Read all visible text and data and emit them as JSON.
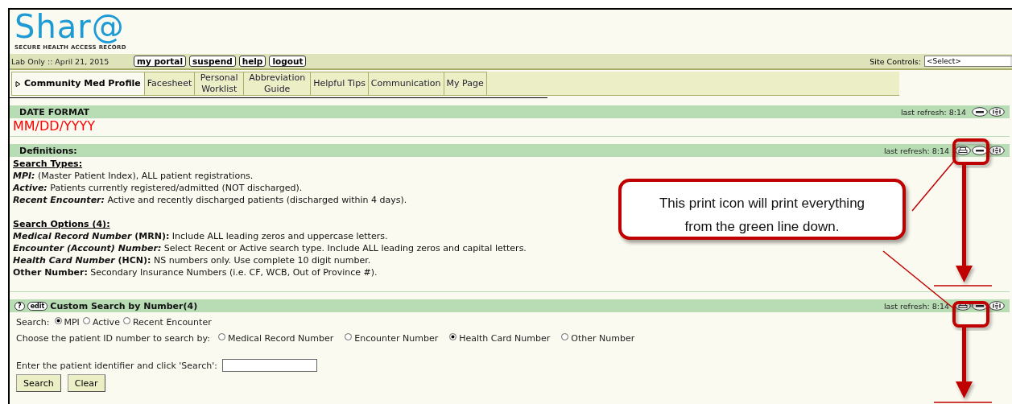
{
  "logo": {
    "name": "Shar@",
    "tagline": "SECURE HEALTH ACCESS RECORD"
  },
  "toolbar": {
    "context": "Lab Only :: April 21, 2015",
    "buttons": [
      "my portal",
      "suspend",
      "help",
      "logout"
    ],
    "site_controls_label": "Site Controls:",
    "site_controls_value": "<Select>"
  },
  "tabs": [
    {
      "label": "Community Med Profile",
      "selected": true
    },
    {
      "label": "Facesheet",
      "selected": false
    },
    {
      "label": "Personal Worklist",
      "selected": false
    },
    {
      "label": "Abbreviation Guide",
      "selected": false
    },
    {
      "label": "Helpful Tips",
      "selected": false
    },
    {
      "label": "Communication",
      "selected": false
    },
    {
      "label": "My Page",
      "selected": false
    }
  ],
  "panels": [
    {
      "title": "DATE FORMAT",
      "refresh": "last refresh: 8:14",
      "printable": false,
      "kind": "date",
      "value": "MM/DD/YYYY"
    },
    {
      "title": "Definitions:",
      "refresh": "last refresh: 8:14",
      "printable": true,
      "kind": "definitions",
      "sections": [
        {
          "heading": "Search Types:",
          "lines": [
            {
              "term": "MPI:",
              "text": " (Master Patient Index), ALL patient registrations."
            },
            {
              "term": "Active:",
              "text": " Patients currently registered/admitted (NOT discharged)."
            },
            {
              "term": "Recent Encounter:",
              "text": " Active and recently discharged patients (discharged within 4 days)."
            }
          ]
        },
        {
          "heading": "Search Options (4):",
          "lines": [
            {
              "term": "Medical Record Number",
              "label": " (MRN):",
              "text": " Include ALL leading zeros and uppercase letters."
            },
            {
              "term": "Encounter (Account) Number:",
              "text": " Select Recent or Active search type. Include ALL leading zeros and capital letters."
            },
            {
              "term": "Health Card Number",
              "label": " (HCN):",
              "text": " NS numbers only. Use complete 10 digit number."
            },
            {
              "label": "Other Number:",
              "text": " Secondary Insurance Numbers (i.e. CF, WCB, Out of Province #)."
            }
          ]
        }
      ]
    },
    {
      "title": "Custom Search by Number(4)",
      "refresh": "last refresh: 8:14",
      "printable": true,
      "head_buttons": [
        "?",
        "edit"
      ],
      "kind": "search",
      "search_label": "Search:",
      "search_types": [
        {
          "label": "MPI",
          "selected": true
        },
        {
          "label": "Active",
          "selected": false
        },
        {
          "label": "Recent Encounter",
          "selected": false
        }
      ],
      "id_label": "Choose the patient ID number to search by:",
      "id_types": [
        {
          "label": "Medical Record Number",
          "selected": false
        },
        {
          "label": "Encounter Number",
          "selected": false
        },
        {
          "label": "Health Card Number",
          "selected": true
        },
        {
          "label": "Other Number",
          "selected": false
        }
      ],
      "identifier_label": "Enter the patient identifier and click 'Search':",
      "actions": [
        "Search",
        "Clear"
      ]
    }
  ],
  "callout": {
    "text": "This print icon will print everything from the green line down."
  }
}
